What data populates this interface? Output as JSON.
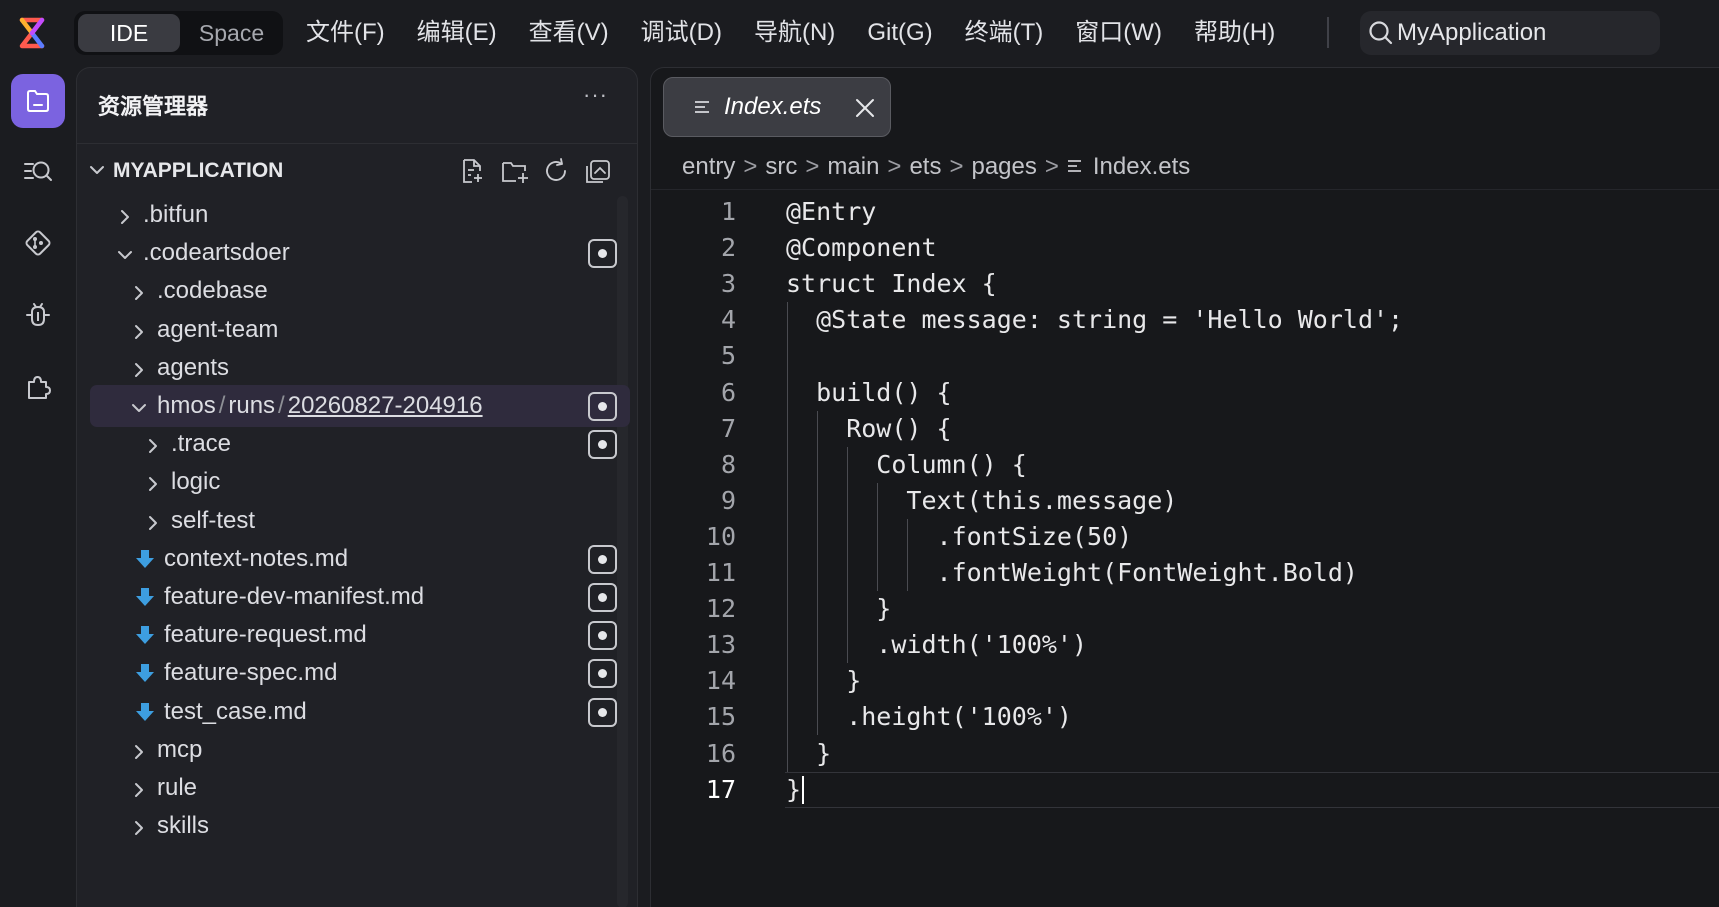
{
  "app": {
    "mode_tabs": [
      "IDE",
      "Space"
    ],
    "active_mode": "IDE",
    "accent_color": "#7b63e0"
  },
  "menu": [
    "文件(F)",
    "编辑(E)",
    "查看(V)",
    "调试(D)",
    "导航(N)",
    "Git(G)",
    "终端(T)",
    "窗口(W)",
    "帮助(H)"
  ],
  "search": {
    "value": "MyApplication",
    "icon": "search-icon"
  },
  "activity_bar": [
    "explorer-icon",
    "search-files-icon",
    "source-control-icon",
    "debug-icon",
    "extensions-icon"
  ],
  "explorer": {
    "title": "资源管理器",
    "more": "···",
    "project": "MYAPPLICATION",
    "tools": [
      "new-file-icon",
      "new-folder-icon",
      "refresh-icon",
      "collapse-all-icon"
    ],
    "tree": [
      {
        "label": ".bitfun",
        "type": "folder",
        "expanded": false,
        "badge": false
      },
      {
        "label": ".codeartsdoer",
        "type": "folder",
        "expanded": true,
        "badge": true
      },
      {
        "label": ".codebase",
        "type": "folder",
        "expanded": false,
        "badge": false
      },
      {
        "label": "agent-team",
        "type": "folder",
        "expanded": false,
        "badge": false
      },
      {
        "label": "agents",
        "type": "folder",
        "expanded": false,
        "badge": false
      },
      {
        "label_parts": [
          "hmos",
          "runs",
          "20260827-204916"
        ],
        "label": "hmos/runs/20260827-204916",
        "type": "folder",
        "expanded": true,
        "badge": true,
        "selected": true
      },
      {
        "label": ".trace",
        "type": "folder",
        "expanded": false,
        "badge": true
      },
      {
        "label": "logic",
        "type": "folder",
        "expanded": false,
        "badge": false
      },
      {
        "label": "self-test",
        "type": "folder",
        "expanded": false,
        "badge": false
      },
      {
        "label": "context-notes.md",
        "type": "md",
        "badge": true
      },
      {
        "label": "feature-dev-manifest.md",
        "type": "md",
        "badge": true
      },
      {
        "label": "feature-request.md",
        "type": "md",
        "badge": true
      },
      {
        "label": "feature-spec.md",
        "type": "md",
        "badge": true
      },
      {
        "label": "test_case.md",
        "type": "md",
        "badge": true
      },
      {
        "label": "mcp",
        "type": "folder",
        "expanded": false,
        "badge": false
      },
      {
        "label": "rule",
        "type": "folder",
        "expanded": false,
        "badge": false
      },
      {
        "label": "skills",
        "type": "folder",
        "expanded": false,
        "badge": false
      }
    ]
  },
  "editor": {
    "tab": {
      "name": "Index.ets",
      "close": "close-icon"
    },
    "breadcrumb": [
      "entry",
      "src",
      "main",
      "ets",
      "pages",
      "Index.ets"
    ],
    "current_line": 17,
    "lines": [
      {
        "n": "1",
        "code": "@Entry"
      },
      {
        "n": "2",
        "code": "@Component"
      },
      {
        "n": "3",
        "code": "struct Index {"
      },
      {
        "n": "4",
        "code": "  @State message: string = 'Hello World';"
      },
      {
        "n": "5",
        "code": ""
      },
      {
        "n": "6",
        "code": "  build() {"
      },
      {
        "n": "7",
        "code": "    Row() {"
      },
      {
        "n": "8",
        "code": "      Column() {"
      },
      {
        "n": "9",
        "code": "        Text(this.message)"
      },
      {
        "n": "10",
        "code": "          .fontSize(50)"
      },
      {
        "n": "11",
        "code": "          .fontWeight(FontWeight.Bold)"
      },
      {
        "n": "12",
        "code": "      }"
      },
      {
        "n": "13",
        "code": "      .width('100%')"
      },
      {
        "n": "14",
        "code": "    }"
      },
      {
        "n": "15",
        "code": "    .height('100%')"
      },
      {
        "n": "16",
        "code": "  }"
      },
      {
        "n": "17",
        "code": "}"
      }
    ]
  }
}
